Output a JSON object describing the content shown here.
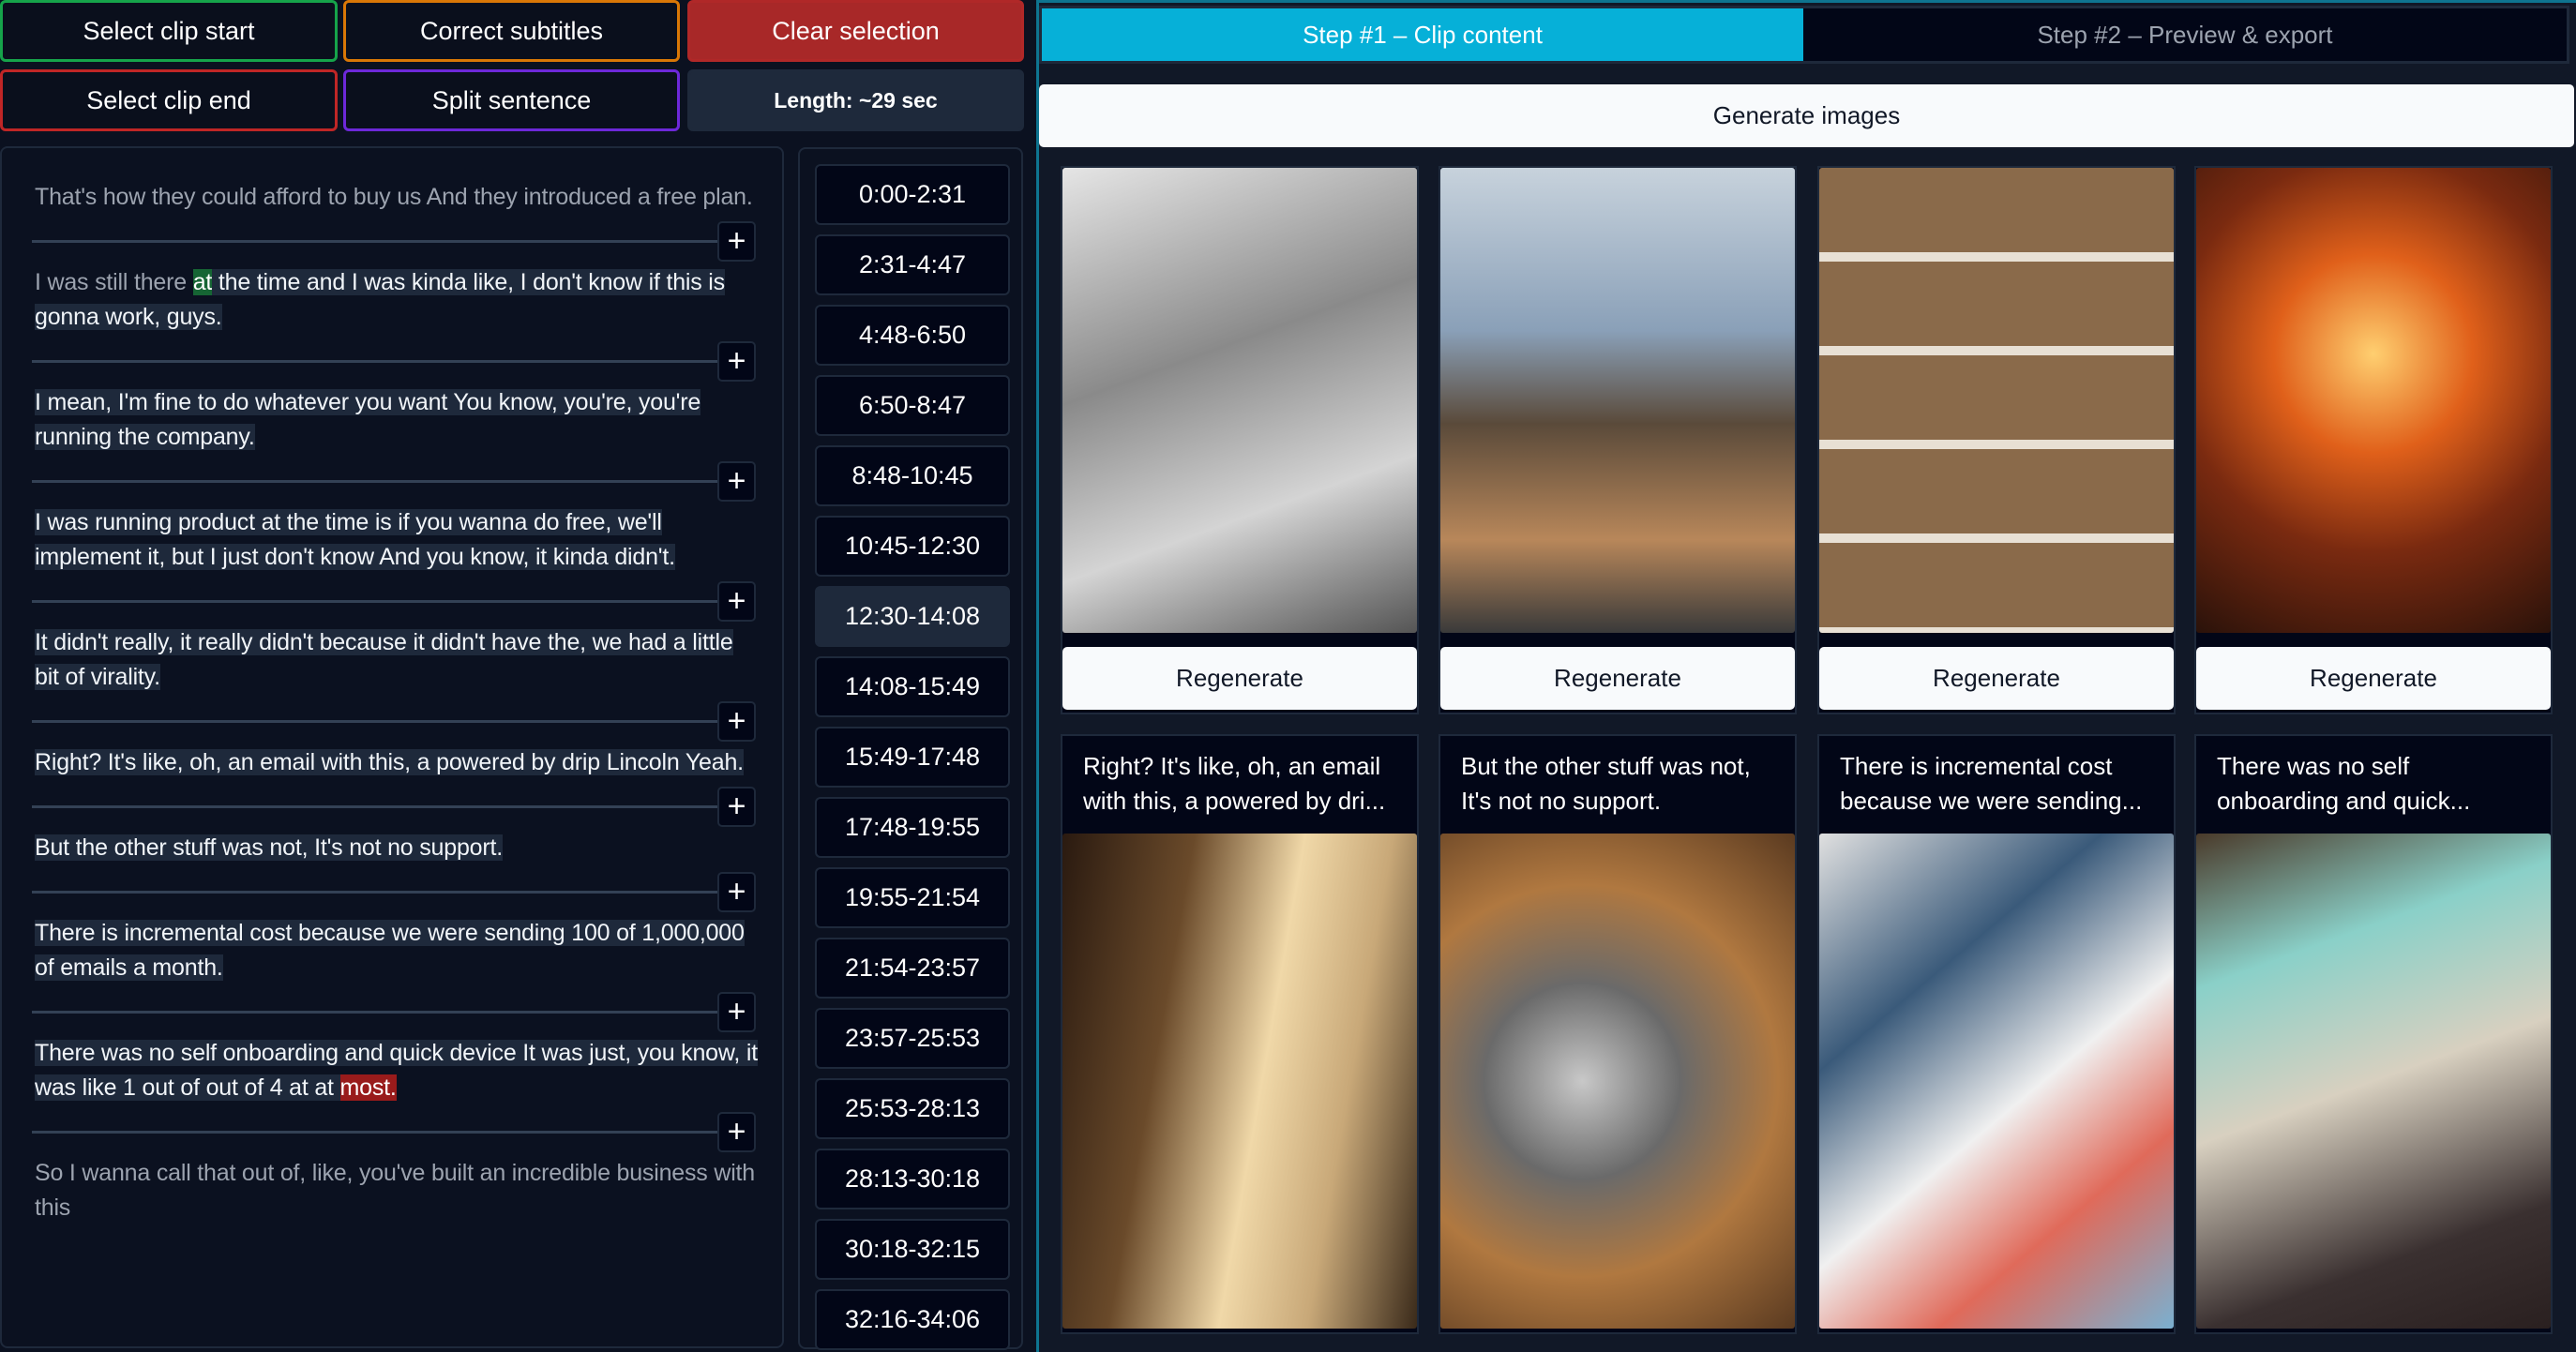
{
  "toolbar": {
    "select_clip_start": "Select clip start",
    "correct_subtitles": "Correct subtitles",
    "clear_selection": "Clear selection",
    "select_clip_end": "Select clip end",
    "split_sentence": "Split sentence",
    "length": "Length: ~29 sec"
  },
  "transcript": [
    {
      "before": "That's how they could afford to buy us And they introduced a free plan.",
      "selected": "",
      "mark": "",
      "after": "",
      "mark_color": ""
    },
    {
      "before": "I was still there ",
      "mark": "at",
      "mark_color": "green",
      "selected": " the time and I was kinda like, I don't know if this is gonna work, guys.",
      "after": ""
    },
    {
      "before": "",
      "mark": "",
      "selected": "I mean, I'm fine to do whatever you want You know, you're, you're running the company.",
      "after": ""
    },
    {
      "before": "",
      "mark": "",
      "selected": "I was running product at the time is if you wanna do free, we'll implement it, but I just don't know And you know, it kinda didn't.",
      "after": ""
    },
    {
      "before": "",
      "mark": "",
      "selected": "It didn't really, it really didn't because it didn't have the, we had a little bit of virality.",
      "after": ""
    },
    {
      "before": "",
      "mark": "",
      "selected": "Right? It's like, oh, an email with this, a powered by drip Lincoln Yeah.",
      "after": ""
    },
    {
      "before": "",
      "mark": "",
      "selected": "But the other stuff was not, It's not no support.",
      "after": ""
    },
    {
      "before": "",
      "mark": "",
      "selected": "There is incremental cost because we were sending 100 of 1,000,000 of emails a month.",
      "after": ""
    },
    {
      "before": "",
      "selected": "There was no self onboarding and quick device It was just, you know, it was like 1 out of out of 4 at at ",
      "mark": "most.",
      "mark_color": "red",
      "after": "",
      "mark_after": true
    },
    {
      "before": "So I wanna call that out of, like, you've built an incredible business with this",
      "mark": "",
      "selected": "",
      "after": ""
    }
  ],
  "times": [
    "0:00-2:31",
    "2:31-4:47",
    "4:48-6:50",
    "6:50-8:47",
    "8:48-10:45",
    "10:45-12:30",
    "12:30-14:08",
    "14:08-15:49",
    "15:49-17:48",
    "17:48-19:55",
    "19:55-21:54",
    "21:54-23:57",
    "23:57-25:53",
    "25:53-28:13",
    "28:13-30:18",
    "30:18-32:15",
    "32:16-34:06"
  ],
  "active_time": "12:30-14:08",
  "tabs": [
    {
      "label": "Step #1 – Clip content",
      "active": true
    },
    {
      "label": "Step #2 – Preview & export",
      "active": false
    }
  ],
  "generate_label": "Generate images",
  "regenerate_label": "Regenerate",
  "row1_images": [
    "architects-sketch-image",
    "city-boardroom-image",
    "office-collage-image",
    "fire-logs-image"
  ],
  "row2": [
    {
      "caption": "Right? It's like, oh, an email with this, a powered by dri...",
      "image": "coffee-window-image"
    },
    {
      "caption": "But the other stuff was not, It's not no support.",
      "image": "metal-parts-image"
    },
    {
      "caption": "There is incremental cost because we were sending...",
      "image": "laptop-charts-image"
    },
    {
      "caption": "There was no self onboarding and quick...",
      "image": "retro-computers-image"
    }
  ],
  "colors": {
    "accent": "#06b0d8",
    "green": "#16a34a",
    "orange": "#d97706",
    "red": "#b91c1c",
    "purple": "#6d28d9"
  }
}
